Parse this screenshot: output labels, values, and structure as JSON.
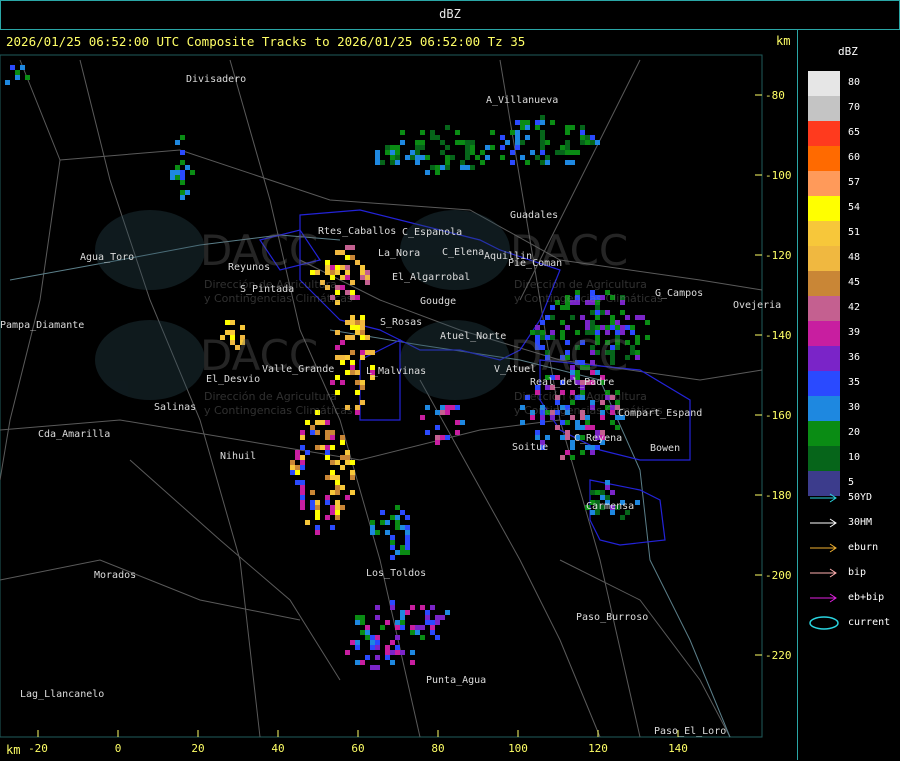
{
  "window": {
    "title": "dBZ"
  },
  "header": {
    "caption": "2026/01/25 06:52:00 UTC Composite Tracks to 2026/01/25 06:52:00 Tz 35",
    "km_label": "km"
  },
  "axes": {
    "y_ticks": [
      "-80",
      "-100",
      "-120",
      "-140",
      "-160",
      "-180",
      "-200",
      "-220"
    ],
    "x_ticks": [
      "-20",
      "0",
      "20",
      "40",
      "60",
      "80",
      "100",
      "120",
      "140"
    ],
    "x_unit": "km"
  },
  "legend": {
    "title": "dBZ",
    "levels": [
      {
        "value": "80",
        "color": "#e6e6e6"
      },
      {
        "value": "70",
        "color": "#c4c4c4"
      },
      {
        "value": "65",
        "color": "#ff3a1e"
      },
      {
        "value": "60",
        "color": "#ff6a00"
      },
      {
        "value": "57",
        "color": "#ff9a5a"
      },
      {
        "value": "54",
        "color": "#ffff00"
      },
      {
        "value": "51",
        "color": "#f7c73a"
      },
      {
        "value": "48",
        "color": "#f0b840"
      },
      {
        "value": "45",
        "color": "#c98636"
      },
      {
        "value": "42",
        "color": "#c46090"
      },
      {
        "value": "39",
        "color": "#c81ea0"
      },
      {
        "value": "36",
        "color": "#7a24c8"
      },
      {
        "value": "35",
        "color": "#2a4aff"
      },
      {
        "value": "30",
        "color": "#1e88e0"
      },
      {
        "value": "20",
        "color": "#0a8c14"
      },
      {
        "value": "10",
        "color": "#06651a"
      },
      {
        "value": "5",
        "color": "#3c3c8c"
      }
    ],
    "tracks": [
      {
        "label": "50YD",
        "color": "#2ad4e0"
      },
      {
        "label": "30HM",
        "color": "#ffffff"
      },
      {
        "label": "eburn",
        "color": "#f0b030"
      },
      {
        "label": "bip",
        "color": "#ffb0b0"
      },
      {
        "label": "eb+bip",
        "color": "#e020e0"
      },
      {
        "label": "current",
        "color": "#2ad4e0"
      }
    ]
  },
  "places": [
    {
      "name": "Divisadero"
    },
    {
      "name": "A_Villanueva"
    },
    {
      "name": "Guadales"
    },
    {
      "name": "C_Espanola"
    },
    {
      "name": "La_Nora"
    },
    {
      "name": "C_Elena"
    },
    {
      "name": "Aquillin"
    },
    {
      "name": "Pie_Coman"
    },
    {
      "name": "El_Algarrobal"
    },
    {
      "name": "Goudge"
    },
    {
      "name": "G_Campos"
    },
    {
      "name": "Ovejeria"
    },
    {
      "name": "Rtes_Caballos"
    },
    {
      "name": "Agua_Toro"
    },
    {
      "name": "Reyunos"
    },
    {
      "name": "S_Pintada"
    },
    {
      "name": "S_Rosas"
    },
    {
      "name": "Atuel_Norte"
    },
    {
      "name": "El_Desvio"
    },
    {
      "name": "Valle_Grande"
    },
    {
      "name": "L_Malvinas"
    },
    {
      "name": "V_Atuel"
    },
    {
      "name": "Salinas"
    },
    {
      "name": "Cda_Amarilla"
    },
    {
      "name": "Pampa_Diamante"
    },
    {
      "name": "Nihuil"
    },
    {
      "name": "Soitue"
    },
    {
      "name": "C_Reyena"
    },
    {
      "name": "Bowen"
    },
    {
      "name": "Compart_Espand"
    },
    {
      "name": "Real_del_Padre"
    },
    {
      "name": "Carmensa"
    },
    {
      "name": "Morados"
    },
    {
      "name": "Los_Toldos"
    },
    {
      "name": "Paso_Burroso"
    },
    {
      "name": "Punta_Agua"
    },
    {
      "name": "Lag_Llancanelo"
    },
    {
      "name": "Paso_El_Loro"
    }
  ],
  "watermark": {
    "brand": "DACC",
    "line1": "Dirección de Agricultura",
    "line2": "y Contingencias Climáticas"
  }
}
